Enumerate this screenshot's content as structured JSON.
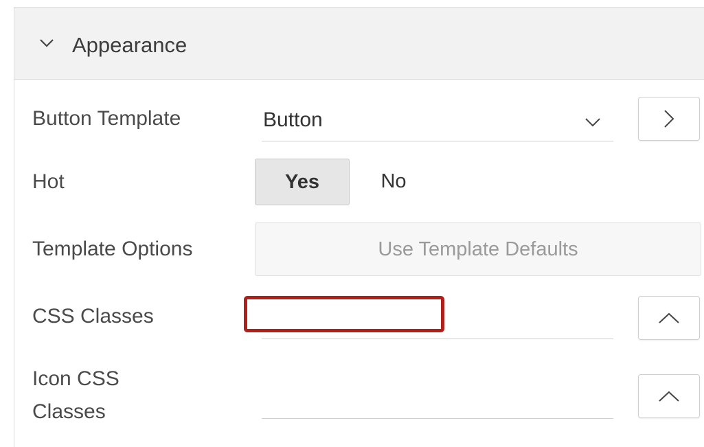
{
  "section": {
    "title": "Appearance",
    "toggle_icon": "chevron-down-icon"
  },
  "fields": {
    "button_template": {
      "label": "Button Template",
      "value": "Button",
      "dropdown_icon": "chevron-down-icon",
      "side_icon": "chevron-right-icon"
    },
    "hot": {
      "label": "Hot",
      "options": [
        "Yes",
        "No"
      ],
      "selected": "Yes"
    },
    "template_options": {
      "label": "Template Options",
      "button_label": "Use Template Defaults"
    },
    "css_classes": {
      "label": "CSS Classes",
      "value": "",
      "side_icon": "chevron-up-icon"
    },
    "icon_css_classes": {
      "label_line1": "Icon CSS",
      "label_line2": "Classes",
      "value": "",
      "side_icon": "chevron-up-icon"
    }
  },
  "colors": {
    "header_bg": "#f2f2f2",
    "highlight": "#b0201a",
    "selected_toggle_bg": "#e6e6e6"
  }
}
